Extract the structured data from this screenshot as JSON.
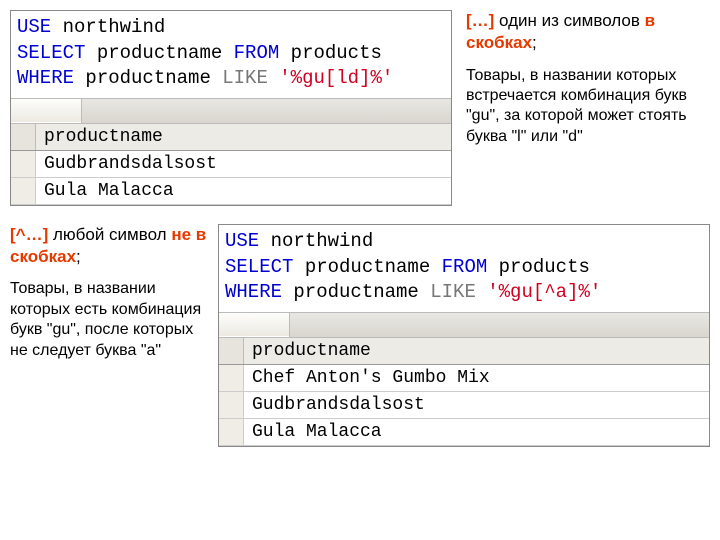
{
  "top": {
    "sql": {
      "kw_use": "USE",
      "db": "northwind",
      "kw_select": "SELECT",
      "col": "productname",
      "kw_from": "FROM",
      "table": "products",
      "kw_where": "WHERE",
      "col2": "productname",
      "kw_like": "LIKE",
      "literal": "'%gu[ld]%'"
    },
    "header": "productname",
    "rows": [
      "Gudbrandsdalsost",
      "Gula Malacca"
    ],
    "caption_pattern": "[…]",
    "caption_rest": " один из символов ",
    "caption_bold": "в скобках",
    "caption_semicolon": ";",
    "description": "Товары, в названии которых встречается комбинация букв \"gu\", за которой может стоять буква \"l\" или \"d\""
  },
  "bottom": {
    "sql": {
      "kw_use": "USE",
      "db": "northwind",
      "kw_select": "SELECT",
      "col": "productname",
      "kw_from": "FROM",
      "table": "products",
      "kw_where": "WHERE",
      "col2": "productname",
      "kw_like": "LIKE",
      "literal": "'%gu[^a]%'"
    },
    "header": "productname",
    "rows": [
      "Chef Anton's Gumbo Mix",
      "Gudbrandsdalsost",
      "Gula Malacca"
    ],
    "caption_pattern": "[^…]",
    "caption_rest": " любой символ ",
    "caption_bold": "не в скобках",
    "caption_semicolon": ";",
    "description": "Товары, в названии которых есть комбинация букв \"gu\", после которых не следует буква \"a\""
  }
}
